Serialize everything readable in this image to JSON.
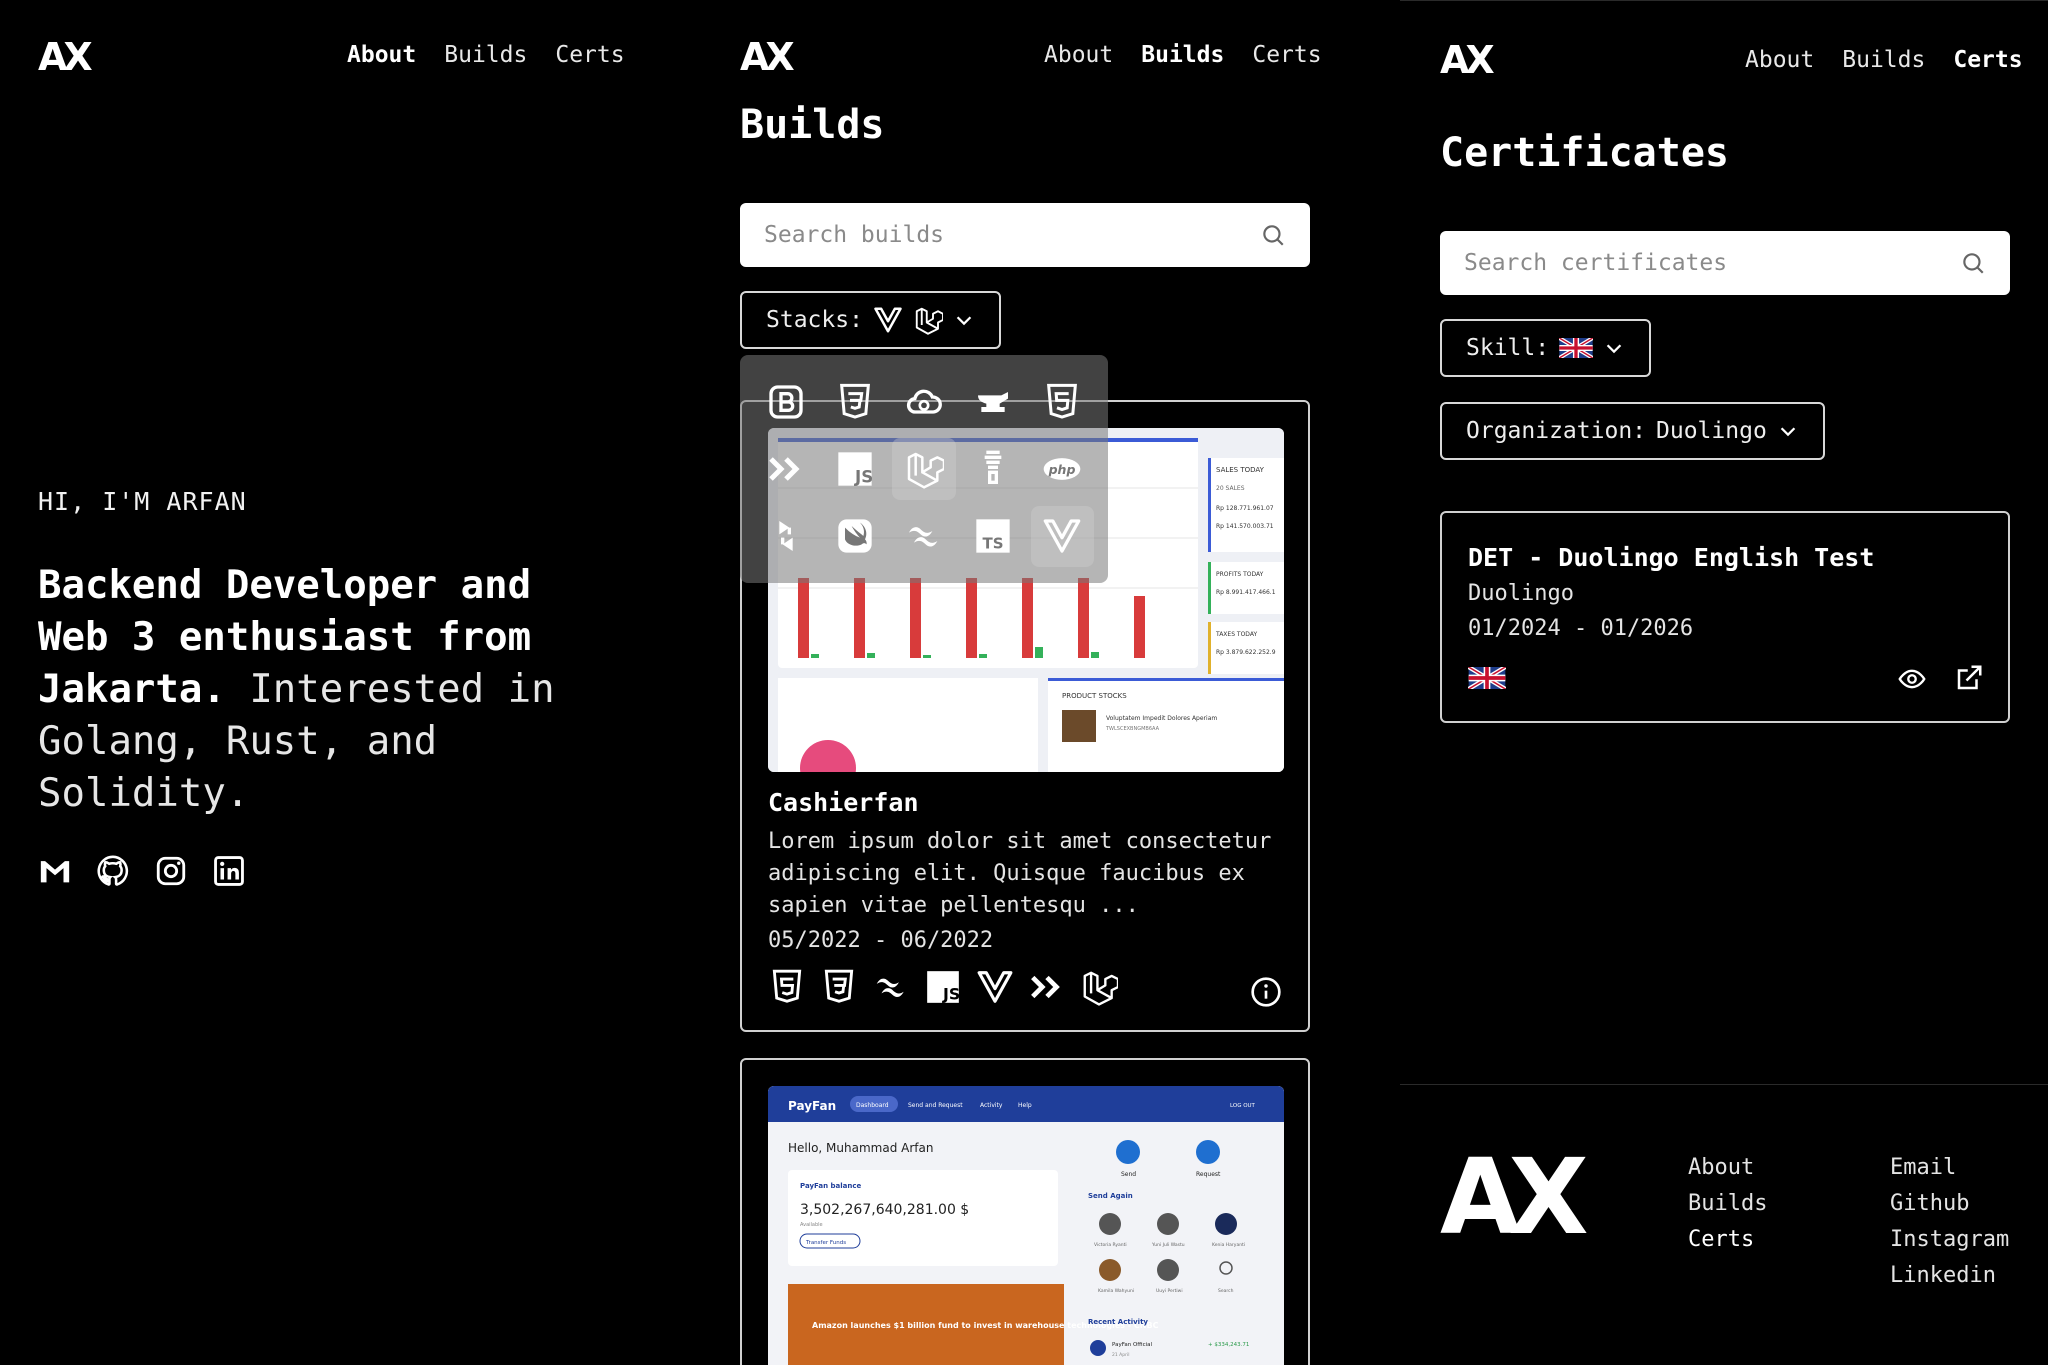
{
  "logo_text": "AX",
  "nav": {
    "about": "About",
    "builds": "Builds",
    "certs": "Certs"
  },
  "about": {
    "greeting": "HI, I'M ARFAN",
    "headline_bold": "Backend Developer and Web 3 enthusiast from Jakarta.",
    "headline_rest": " Interested in Golang, Rust, and Solidity.",
    "socials": [
      "gmail-icon",
      "github-icon",
      "instagram-icon",
      "linkedin-icon"
    ]
  },
  "builds": {
    "title": "Builds",
    "search_placeholder": "Search builds",
    "stacks_label": "Stacks:",
    "stack_options": [
      "bootstrap",
      "css3",
      "cloud",
      "laravel-forge",
      "html5",
      "livewire",
      "javascript",
      "laravel",
      "tinker",
      "php",
      "retool",
      "swift",
      "tailwind",
      "typescript",
      "vue"
    ],
    "selected_stacks": [
      "laravel",
      "vue"
    ],
    "cards": [
      {
        "title": "Cashierfan",
        "description": "Lorem ipsum dolor sit amet consectetur adipiscing elit. Quisque faucibus ex sapien vitae pellentesqu ...",
        "date": "05/2022 - 06/2022",
        "stacks": [
          "html5",
          "css3",
          "tailwind",
          "javascript",
          "vue",
          "livewire",
          "laravel"
        ],
        "screenshot": {
          "labels": [
            "SALES TODAY",
            "20 SALES",
            "Rp 128.771.961.07",
            "Rp 141.570.003.71",
            "PROFITS TODAY",
            "Rp 8.991.417.466.1",
            "TAXES TODAY",
            "Rp 3.879.622.252.9",
            "PRODUCT STOCKS",
            "Voluptatem Impedit Dolores Aperiam",
            "TWLSCEXBNGMB6AA"
          ]
        }
      },
      {
        "title": "",
        "screenshot": {
          "brand": "PayFan",
          "tabs": [
            "Dashboard",
            "Send and Request",
            "Activity",
            "Help"
          ],
          "logout": "LOG OUT",
          "greeting": "Hello, Muhammad Arfan",
          "balance_label": "PayFan balance",
          "balance": "3,502,267,640,281.00 $",
          "available": "Available",
          "transfer": "Transfer Funds",
          "send": "Send",
          "request": "Request",
          "send_again": "Send Again",
          "contacts": [
            "Victoria Ryanti",
            "Yuni Juli Wastu",
            "Kenia Haryanti",
            "Kamila Wahyuni",
            "Uuyi Pertiwi",
            "Search"
          ],
          "news": "Amazon launches $1 billion fund to invest in warehouse technologies - CNBC",
          "recent": "Recent Activity",
          "recent_name": "PayFan Official",
          "recent_date": "21 April",
          "recent_amount": "+ $334,243.71"
        }
      }
    ]
  },
  "certs": {
    "title": "Certificates",
    "search_placeholder": "Search certificates",
    "skill_label": "Skill:",
    "org_label": "Organization:",
    "org_value": "Duolingo",
    "card": {
      "title": "DET - Duolingo English Test",
      "org": "Duolingo",
      "date": "01/2024 - 01/2026",
      "flag": "uk-flag-icon"
    }
  },
  "footer": {
    "pages": [
      "About",
      "Builds",
      "Certs"
    ],
    "links": [
      "Email",
      "Github",
      "Instagram",
      "Linkedin"
    ]
  },
  "colors": {
    "background": "#000000",
    "text": "#ffffff",
    "search_bg": "#ffffff",
    "panel_border": "#d0d0d0"
  }
}
